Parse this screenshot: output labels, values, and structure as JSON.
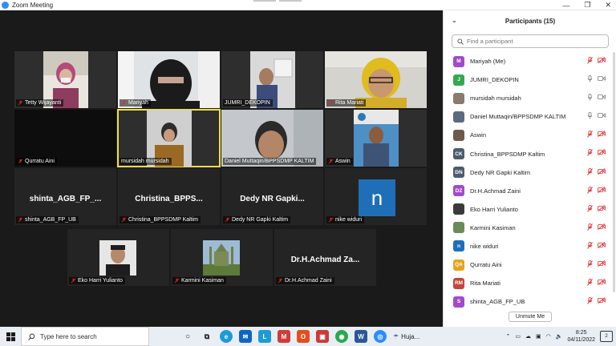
{
  "window": {
    "title": "Zoom Meeting",
    "controls": [
      "—",
      "❐",
      "✕"
    ]
  },
  "gallery": {
    "tiles": [
      {
        "name": "Tetty Wijayanti",
        "type": "video"
      },
      {
        "name": "Mariyah",
        "type": "video"
      },
      {
        "name": "JUMRI_DEKOPIN",
        "type": "video"
      },
      {
        "name": "Rita Mariati",
        "type": "video"
      },
      {
        "name": "Qurratu Aini",
        "type": "blank"
      },
      {
        "name": "mursidah mursidah",
        "type": "video",
        "active": true
      },
      {
        "name": "Daniel Muttaqin/BPPSDMP KALTIM",
        "type": "video"
      },
      {
        "name": "Aswin",
        "type": "video"
      },
      {
        "name": "shinta_AGB_FP_UB",
        "display": "shinta_AGB_FP_...",
        "type": "name"
      },
      {
        "name": "Christina_BPPSDMP Kaltim",
        "display": "Christina_BPPS...",
        "type": "name"
      },
      {
        "name": "Dedy NR Gapki Kaltim",
        "display": "Dedy NR Gapki...",
        "type": "name"
      },
      {
        "name": "nike widuri",
        "display": "n",
        "type": "avatar"
      },
      {
        "name": "Eko Harri Yulianto",
        "type": "photo"
      },
      {
        "name": "Karmini Kasiman",
        "type": "photo"
      },
      {
        "name": "Dr.H.Achmad Zaini",
        "display": "Dr.H.Achmad Za...",
        "type": "name"
      }
    ]
  },
  "participants": {
    "header": "Participants (15)",
    "search_placeholder": "Find a participant",
    "items": [
      {
        "initials": "M",
        "color": "#a24bc9",
        "name": "Mariyah (Me)",
        "mic": "muted",
        "video": "off"
      },
      {
        "initials": "J",
        "color": "#35a84f",
        "name": "JUMRI_DEKOPIN",
        "mic": "on",
        "video": "on"
      },
      {
        "initials": "",
        "color": "#8a7a6a",
        "name": "mursidah mursidah",
        "mic": "on",
        "video": "on"
      },
      {
        "initials": "",
        "color": "#5b6a80",
        "name": "Daniel Muttaqin/BPPSDMP KALTIM",
        "mic": "on",
        "video": "on"
      },
      {
        "initials": "",
        "color": "#6d5a4a",
        "name": "Aswin",
        "mic": "muted",
        "video": "off"
      },
      {
        "initials": "CK",
        "color": "#4d5b6b",
        "name": "Christina_BPPSDMP Kaltim",
        "mic": "muted",
        "video": "off"
      },
      {
        "initials": "DN",
        "color": "#4d5b6b",
        "name": "Dedy NR Gapki Kaltim",
        "mic": "muted",
        "video": "off"
      },
      {
        "initials": "DZ",
        "color": "#a24bc9",
        "name": "Dr.H.Achmad Zaini",
        "mic": "muted",
        "video": "off"
      },
      {
        "initials": "",
        "color": "#3a3a3a",
        "name": "Eko Harri Yulianto",
        "mic": "muted",
        "video": "off"
      },
      {
        "initials": "",
        "color": "#6a8a5a",
        "name": "Karmini Kasiman",
        "mic": "muted",
        "video": "off"
      },
      {
        "initials": "n",
        "color": "#1f6fb8",
        "name": "nike widuri",
        "mic": "muted",
        "video": "off"
      },
      {
        "initials": "QA",
        "color": "#e8a21e",
        "name": "Qurratu Aini",
        "mic": "muted",
        "video": "off"
      },
      {
        "initials": "RM",
        "color": "#c8443a",
        "name": "Rita Mariati",
        "mic": "muted",
        "video": "off"
      },
      {
        "initials": "S",
        "color": "#a24bc9",
        "name": "shinta_AGB_FP_UB",
        "mic": "muted",
        "video": "off"
      }
    ],
    "unmute_label": "Unmute Me"
  },
  "taskbar": {
    "search_placeholder": "Type here to search",
    "active_window": "Huja...",
    "time": "8:25",
    "date": "04/11/2022",
    "notifications": "2"
  },
  "colors": {
    "muted": "#e02828",
    "accent": "#2d8cff",
    "active_speaker": "#f4e03c"
  }
}
